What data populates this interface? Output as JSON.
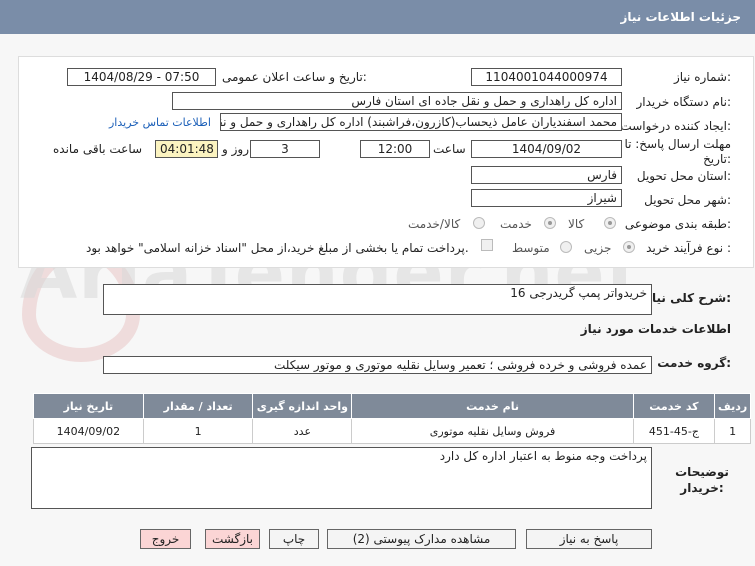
{
  "titlebar": {
    "title": "جزئیات اطلاعات نیاز"
  },
  "form": {
    "need_number_label": "شماره نیاز:",
    "need_number": "1104001044000974",
    "announce_label": "تاریخ و ساعت اعلان عمومی:",
    "announce_value": "1404/08/29 - 07:50",
    "buyer_org_label": "نام دستگاه خریدار:",
    "buyer_org": "اداره کل راهداری و حمل و نقل جاده ای استان فارس",
    "creator_label": "ایجاد کننده درخواست:",
    "creator": "محمد اسفندیاران عامل ذیحساب(کازرون،فراشبند) اداره کل راهداری و حمل و نقل",
    "contact_link": "اطلاعات تماس خریدار",
    "deadline_label": "مهلت ارسال پاسخ: تا تاریخ:",
    "deadline_date": "1404/09/02",
    "time_label": "ساعت",
    "deadline_time": "12:00",
    "days_value": "3",
    "days_label": "روز و",
    "remaining_time": "04:01:48",
    "remaining_label": "ساعت باقی مانده",
    "province_label": "استان محل تحویل:",
    "province": "فارس",
    "city_label": "شهر محل تحویل:",
    "city": "شیراز",
    "category_label": "طبقه بندی موضوعی:",
    "category_options": [
      "کالا",
      "خدمت",
      "کالا/خدمت"
    ],
    "purchase_type_label": "نوع فرآیند خرید :",
    "purchase_options": [
      "جزیی",
      "متوسط"
    ],
    "purchase_note": "پرداخت تمام یا بخشی از مبلغ خرید،از محل \"اسناد خزانه اسلامی\" خواهد بود."
  },
  "summary": {
    "label": "شرح کلی نیاز:",
    "value": "خریدواتر پمپ گریدرجی 16"
  },
  "services": {
    "heading": "اطلاعات خدمات مورد نیاز",
    "group_label": "گروه خدمت:",
    "group_value": "عمده فروشی و خرده فروشی ؛ تعمیر وسایل نقلیه موتوری و موتور سیکلت"
  },
  "table": {
    "headers": [
      "ردیف",
      "کد خدمت",
      "نام خدمت",
      "واحد اندازه گیری",
      "تعداد / مقدار",
      "تاریخ نیاز"
    ],
    "rows": [
      [
        "1",
        "ج-45-451",
        "فروش وسایل نقلیه موتوری",
        "عدد",
        "1",
        "1404/09/02"
      ]
    ]
  },
  "notes": {
    "label": "توضیحات خریدار:",
    "value": "پرداخت وجه منوط به اعتبار اداره کل دارد"
  },
  "buttons": {
    "reply": "پاسخ به نیاز",
    "attachments": "مشاهده مدارک پیوستی (2)",
    "print": "چاپ",
    "back": "بازگشت",
    "exit": "خروج"
  },
  "watermark": "AriaTender.net"
}
